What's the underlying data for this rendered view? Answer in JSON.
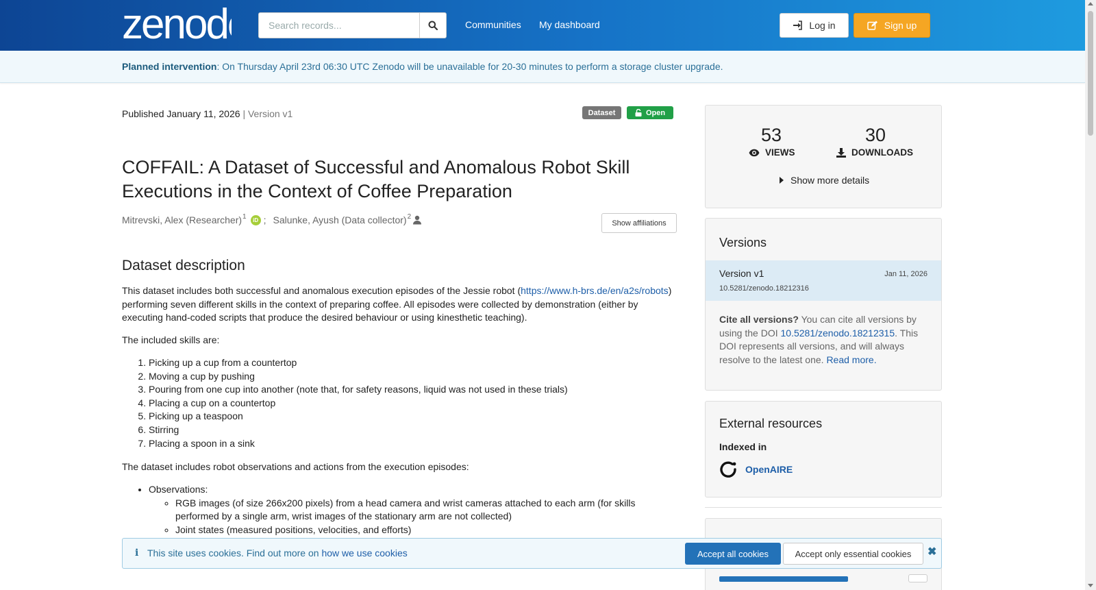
{
  "header": {
    "logo_text": "zenodo",
    "search_placeholder": "Search records...",
    "nav": [
      "Communities",
      "My dashboard"
    ],
    "login_label": "Log in",
    "signup_label": "Sign up"
  },
  "banner": {
    "bold": "Planned intervention",
    "text": ": On Thursday April 23rd 06:30 UTC Zenodo will be unavailable for 20-30 minutes to perform a storage cluster upgrade."
  },
  "record": {
    "published": "Published January 11, 2026",
    "version": "| Version v1",
    "badge_type": "Dataset",
    "badge_access": "Open",
    "title": "COFFAIL: A Dataset of Successful and Anomalous Robot Skill Executions in the Context of Coffee Preparation",
    "authors": [
      {
        "name": "Mitrevski, Alex (Researcher)",
        "sup": "1",
        "after": ";"
      },
      {
        "name": "Salunke, Ayush (Data collector)",
        "sup": "2"
      }
    ],
    "show_affiliations": "Show affiliations",
    "section_title": "Dataset description",
    "intro_before": "This dataset includes both successful and anomalous execution episodes of the Jessie robot (",
    "intro_link": "https://www.h-brs.de/en/a2s/robots",
    "intro_after": ") performing seven different skills in the context of preparing coffee. All episodes were collected by demonstration (either by executing hand-coded scripts that produce the desired behaviour or using kinesthetic teaching).",
    "skills_intro": "The included skills are:",
    "skills": [
      "Picking up a cup from a countertop",
      "Moving a cup by pushing",
      "Pouring from one cup into another (note that, for safety reasons, liquid was not used in these trials)",
      "Placing a cup on a countertop",
      "Picking up a teaspoon",
      "Stirring",
      "Placing a spoon in a sink"
    ],
    "obs_intro": "The dataset includes robot observations and actions from the execution episodes:",
    "observations_label": "Observations:",
    "observations": [
      "RGB images (of size 266x200 pixels) from a head camera and wrist cameras attached to each arm (for skills performed by a single arm, wrist images of the stationary arm are not collected)",
      "Joint states (measured positions, velocities, and efforts)"
    ]
  },
  "stats": {
    "views": "53",
    "views_label": "VIEWS",
    "downloads": "30",
    "downloads_label": "DOWNLOADS",
    "more_details": "Show more details"
  },
  "versions": {
    "title": "Versions",
    "items": [
      {
        "name": "Version v1",
        "date": "Jan 11, 2026",
        "doi": "10.5281/zenodo.18212316"
      }
    ],
    "cite_bold": "Cite all versions?",
    "cite_text1": " You can cite all versions by using the DOI ",
    "cite_doi": "10.5281/zenodo.18212315",
    "cite_text2": ". This DOI represents all versions, and will always resolve to the latest one. ",
    "read_more": "Read more."
  },
  "external": {
    "title": "External resources",
    "indexed_in": "Indexed in",
    "openaire": "OpenAIRE"
  },
  "cookies": {
    "text": "This site uses cookies. Find out more on ",
    "link": "how we use cookies",
    "accept_all": "Accept all cookies",
    "accept_essential": "Accept only essential cookies"
  },
  "colors": {
    "header_start": "#0d4594",
    "header_end": "#1e9bdf",
    "signup": "#f5a623",
    "open_badge": "#21a047",
    "link": "#1d5ea8"
  }
}
